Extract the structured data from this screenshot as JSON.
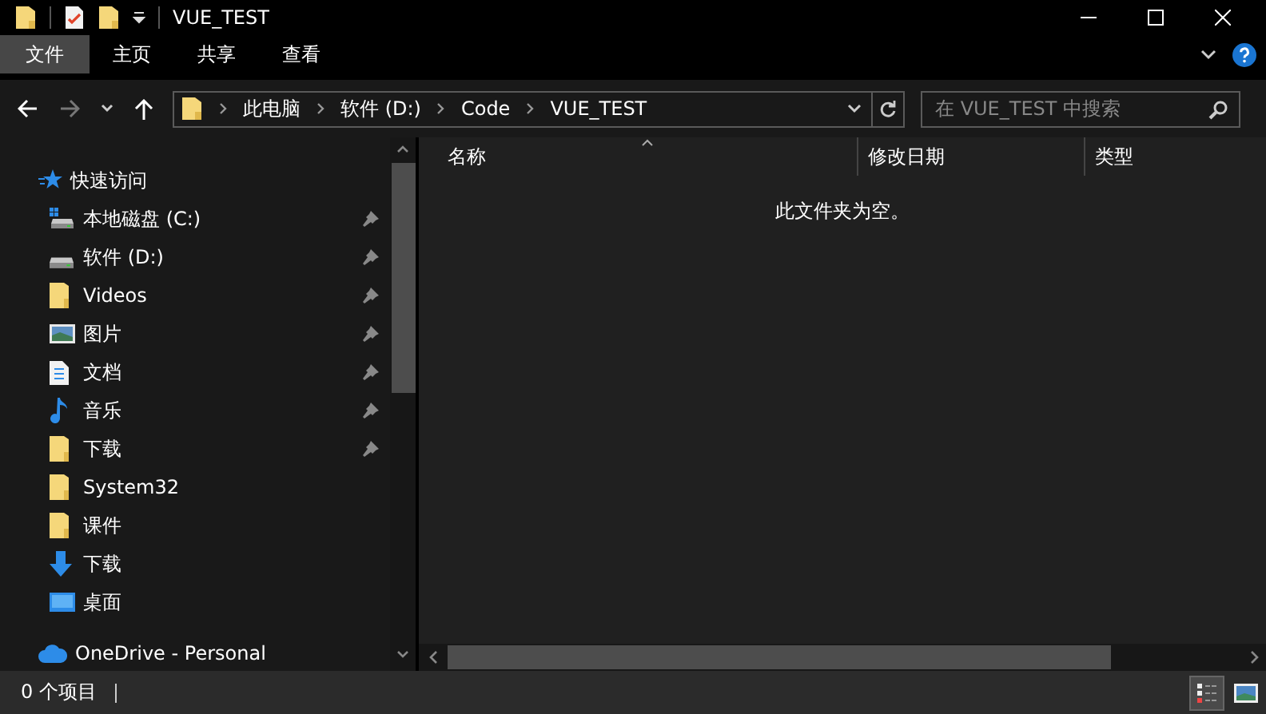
{
  "window": {
    "title": "VUE_TEST"
  },
  "ribbon_tabs": [
    {
      "label": "文件",
      "selected": true
    },
    {
      "label": "主页",
      "selected": false
    },
    {
      "label": "共享",
      "selected": false
    },
    {
      "label": "查看",
      "selected": false
    }
  ],
  "address": {
    "segments": [
      "此电脑",
      "软件 (D:)",
      "Code",
      "VUE_TEST"
    ]
  },
  "search": {
    "placeholder": "在 VUE_TEST 中搜索"
  },
  "nav": [
    {
      "label": "快速访问",
      "kind": "star",
      "children": [
        {
          "label": "本地磁盘 (C:)",
          "kind": "system-drive",
          "pinned": true
        },
        {
          "label": "软件 (D:)",
          "kind": "drive",
          "pinned": true
        },
        {
          "label": "Videos",
          "kind": "folder",
          "pinned": true
        },
        {
          "label": "图片",
          "kind": "pictures",
          "pinned": true
        },
        {
          "label": "文档",
          "kind": "documents",
          "pinned": true
        },
        {
          "label": "音乐",
          "kind": "music",
          "pinned": true
        },
        {
          "label": "下载",
          "kind": "folder",
          "pinned": true
        },
        {
          "label": "System32",
          "kind": "folder",
          "pinned": false
        },
        {
          "label": "课件",
          "kind": "folder",
          "pinned": false
        },
        {
          "label": "下载",
          "kind": "download",
          "pinned": false
        },
        {
          "label": "桌面",
          "kind": "desktop",
          "pinned": false
        }
      ]
    },
    {
      "label": "OneDrive - Personal",
      "kind": "cloud"
    }
  ],
  "columns": [
    "名称",
    "修改日期",
    "类型"
  ],
  "empty_message": "此文件夹为空。",
  "status_bar": {
    "text": "0 个项目"
  },
  "view_buttons": [
    {
      "kind": "details",
      "selected": true
    },
    {
      "kind": "large-icons",
      "selected": false
    }
  ]
}
